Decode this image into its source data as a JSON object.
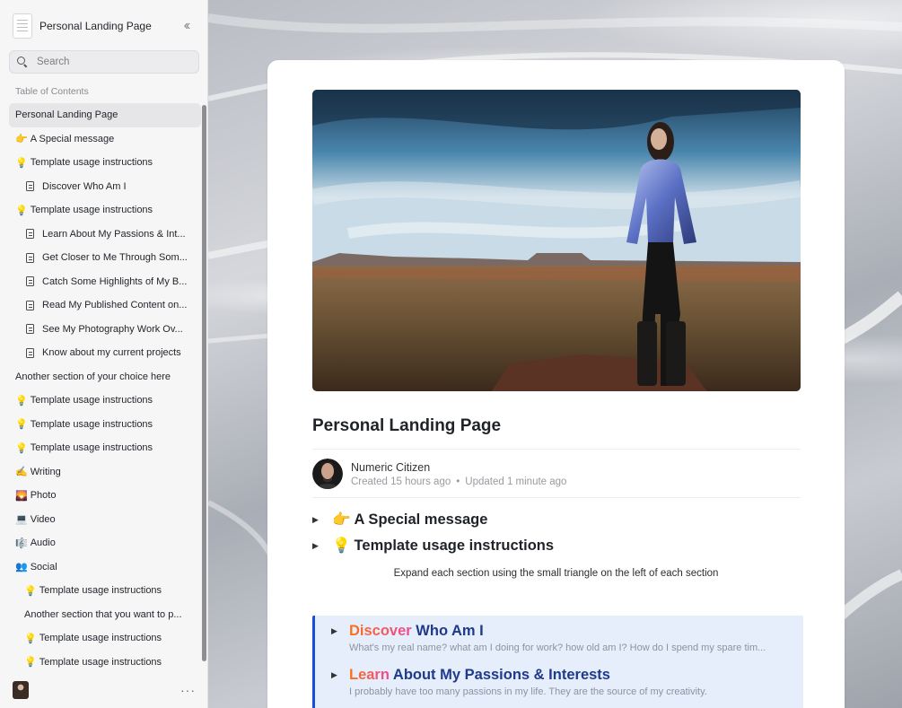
{
  "sidebar": {
    "title": "Personal Landing Page",
    "collapse_icon": "chevrons-left-icon",
    "search": {
      "placeholder": "Search"
    },
    "toc_label": "Table of Contents",
    "items": [
      {
        "label": "Personal Landing Page",
        "emoji": "",
        "icon": "",
        "level": 1,
        "active": true
      },
      {
        "label": "A Special message",
        "emoji": "👉",
        "icon": "",
        "level": 1
      },
      {
        "label": "Template usage instructions",
        "emoji": "💡",
        "icon": "",
        "level": 1
      },
      {
        "label": "Discover Who Am I",
        "emoji": "",
        "icon": "page-icon",
        "level": 2
      },
      {
        "label": "Template usage instructions",
        "emoji": "💡",
        "icon": "",
        "level": 1
      },
      {
        "label": "Learn About My Passions & Int...",
        "emoji": "",
        "icon": "page-icon",
        "level": 2
      },
      {
        "label": "Get Closer to Me Through Som...",
        "emoji": "",
        "icon": "page-icon",
        "level": 2
      },
      {
        "label": "Catch Some Highlights of My B...",
        "emoji": "",
        "icon": "page-icon",
        "level": 2
      },
      {
        "label": "Read My Published Content on...",
        "emoji": "",
        "icon": "page-icon",
        "level": 2
      },
      {
        "label": "See My Photography Work Ov...",
        "emoji": "",
        "icon": "page-icon",
        "level": 2
      },
      {
        "label": "Know about my current projects",
        "emoji": "",
        "icon": "page-icon",
        "level": 2
      },
      {
        "label": "Another section of your choice here",
        "emoji": "",
        "icon": "",
        "level": 1
      },
      {
        "label": "Template usage instructions",
        "emoji": "💡",
        "icon": "",
        "level": 1
      },
      {
        "label": "Template usage instructions",
        "emoji": "💡",
        "icon": "",
        "level": 1
      },
      {
        "label": "Template usage instructions",
        "emoji": "💡",
        "icon": "",
        "level": 1
      },
      {
        "label": "Writing",
        "emoji": "✍️",
        "icon": "",
        "level": 1
      },
      {
        "label": "Photo",
        "emoji": "🌄",
        "icon": "",
        "level": 1
      },
      {
        "label": "Video",
        "emoji": "💻",
        "icon": "",
        "level": 1
      },
      {
        "label": "Audio",
        "emoji": "🎼",
        "icon": "",
        "level": 1
      },
      {
        "label": "Social",
        "emoji": "👥",
        "icon": "",
        "level": 1
      },
      {
        "label": "Template usage instructions",
        "emoji": "💡",
        "icon": "",
        "level": 3
      },
      {
        "label": "Another section that you want to p...",
        "emoji": "",
        "icon": "",
        "level": 3
      },
      {
        "label": "Template usage instructions",
        "emoji": "💡",
        "icon": "",
        "level": 3
      },
      {
        "label": "Template usage instructions",
        "emoji": "💡",
        "icon": "",
        "level": 3
      }
    ],
    "more_icon": "ellipsis-icon"
  },
  "document": {
    "title": "Personal Landing Page",
    "author": {
      "name": "Numeric Citizen",
      "created": "Created 15 hours ago",
      "separator": "•",
      "updated": "Updated 1 minute ago"
    },
    "toggles": [
      {
        "emoji": "👉",
        "label": "A Special message"
      },
      {
        "emoji": "💡",
        "label": "Template usage instructions"
      }
    ],
    "hint": "Expand each section using the small triangle on the left of each section",
    "callout": [
      {
        "accent": "Discover",
        "rest": " Who Am I",
        "sub": "What's my real name? what am I doing for work? how old am I? How do I spend my spare tim..."
      },
      {
        "accent": "Learn",
        "rest": " About My Passions & Interests",
        "sub": "I probably have too many passions in my life. They are the source of my creativity."
      }
    ]
  },
  "colors": {
    "callout_bg": "#e6eefc",
    "callout_border": "#1d4ed8",
    "heading_blue": "#1e3a8a",
    "accent_gradient": [
      "#f97316",
      "#ec4899"
    ]
  }
}
